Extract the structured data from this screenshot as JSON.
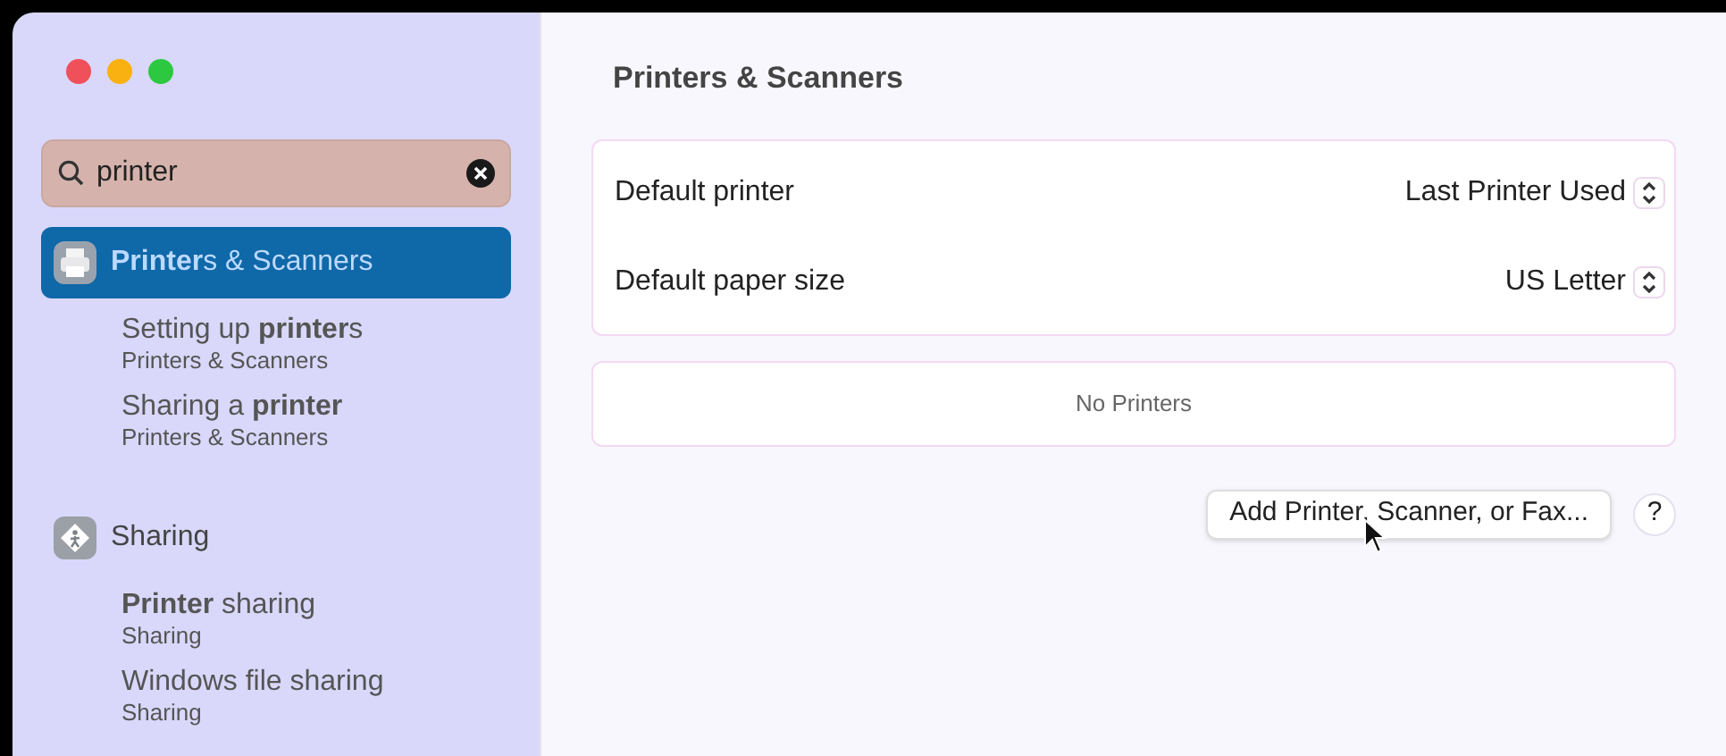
{
  "search": {
    "value": "printer"
  },
  "sections": [
    {
      "kind": "printer",
      "title": "**Printer**s & Scanners",
      "selected": true,
      "results": [
        {
          "title": "Setting up **printer**s",
          "subtitle": "Printers & Scanners"
        },
        {
          "title": "Sharing a **printer**",
          "subtitle": "Printers & Scanners"
        }
      ]
    },
    {
      "kind": "sharing",
      "title": "Sharing",
      "selected": false,
      "results": [
        {
          "title": "**Printer** sharing",
          "subtitle": "Sharing"
        },
        {
          "title": "Windows file sharing",
          "subtitle": "Sharing"
        }
      ]
    }
  ],
  "page_title": "Printers & Scanners",
  "settings": [
    {
      "label": "Default printer",
      "value": "Last Printer Used"
    },
    {
      "label": "Default paper size",
      "value": "US Letter"
    }
  ],
  "printers_empty": "No Printers",
  "add_button": "Add Printer, Scanner, or Fax...",
  "help_button": "?"
}
